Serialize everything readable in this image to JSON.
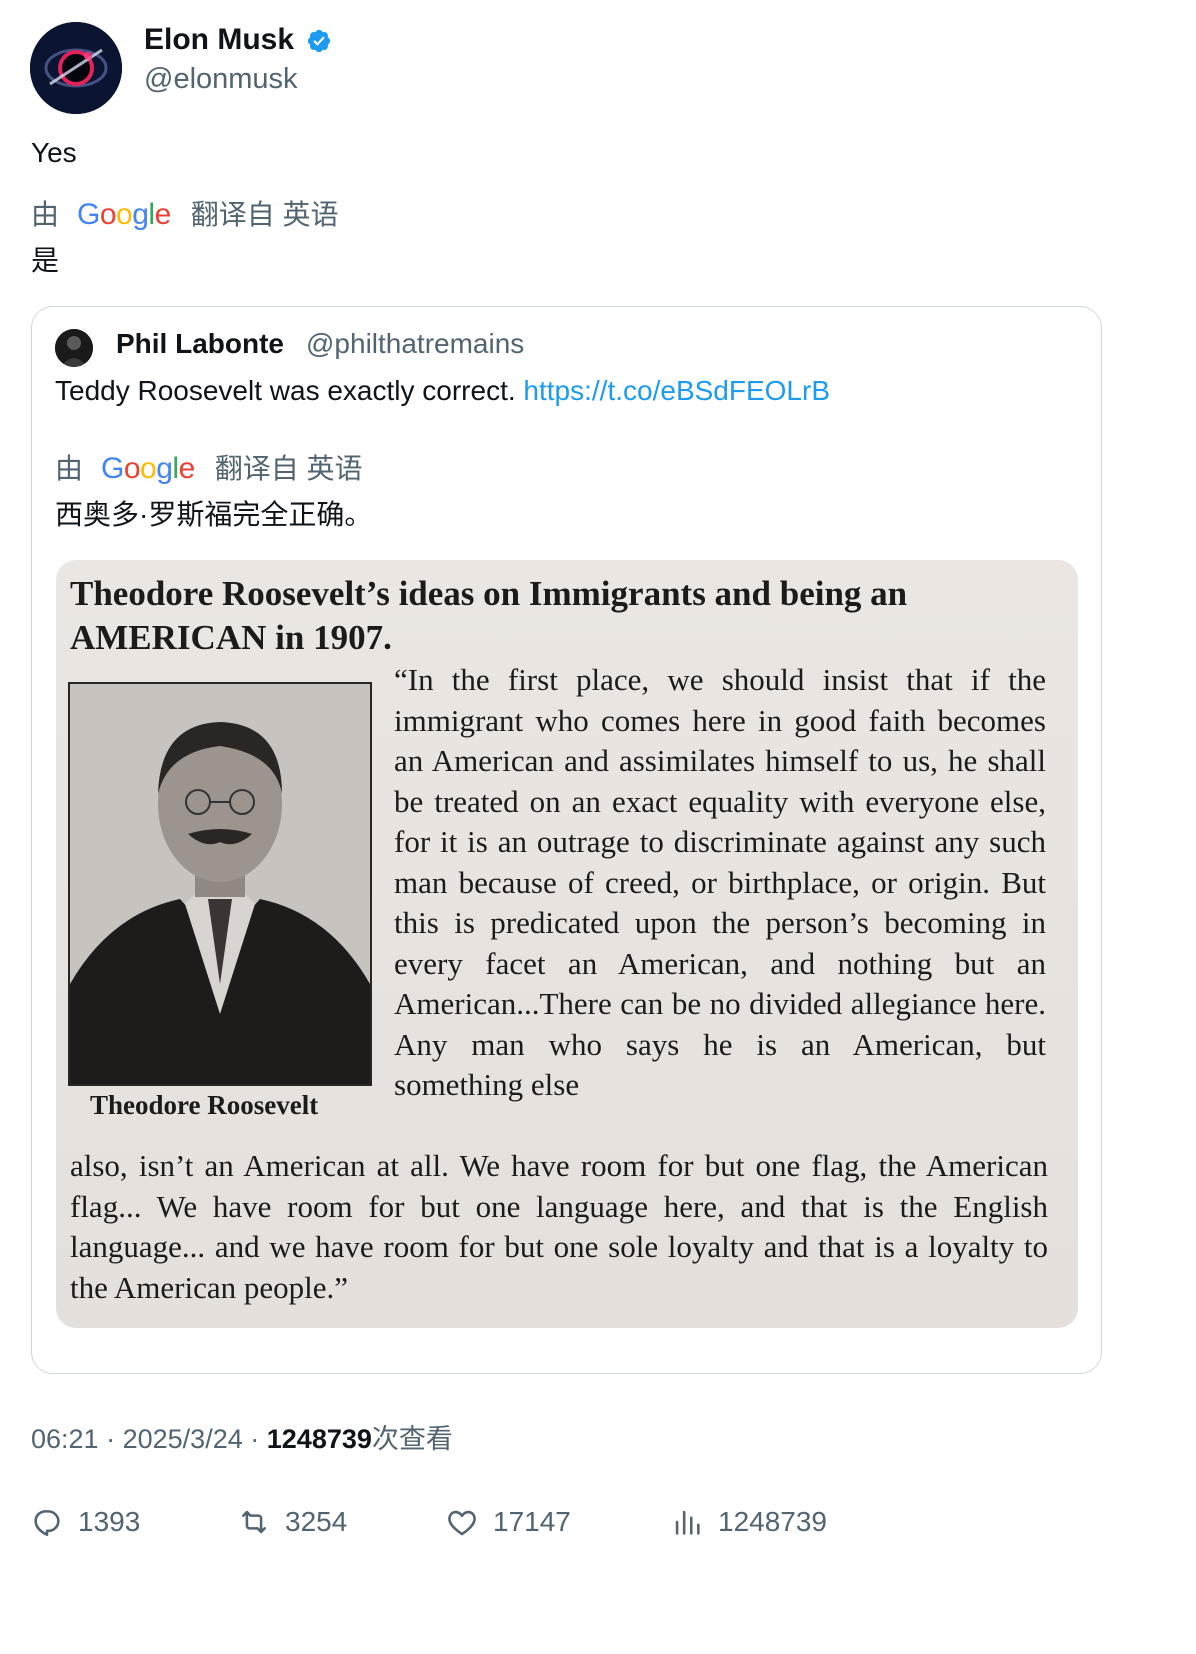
{
  "author": {
    "name": "Elon Musk",
    "handle": "@elonmusk",
    "verified": true,
    "verified_color": "#1d9bf0"
  },
  "tweet": {
    "text": "Yes",
    "translation": {
      "by": "由",
      "provider": "Google",
      "label": "翻译自 英语",
      "text": "是"
    }
  },
  "quoted": {
    "name": "Phil Labonte",
    "handle": "@philthatremains",
    "text": "Teddy Roosevelt was exactly correct.",
    "link": "https://t.co/eBSdFEOLrB",
    "translation": {
      "by": "由",
      "provider": "Google",
      "label": "翻译自 英语",
      "text": "西奥多·罗斯福完全正确。"
    },
    "image": {
      "title": "Theodore Roosevelt’s ideas on Immigrants and being an AMERICAN in 1907.",
      "caption": "Theodore Roosevelt",
      "body_part1": "“In the first place, we should insist that if the immigrant who comes here in good faith becomes an American and assimilates himself to us, he shall be treated on an exact equality with everyone else, for it is an outrage to discriminate against any such man because of creed, or birthplace, or origin. But this is predicated upon the person’s becoming in every facet an American, and nothing but an American...There can be no divided allegiance here. Any man who says he is an American, but something else",
      "body_part2": "also, isn’t an American at all. We have room for but one flag, the American flag... We have room for but one language here, and that is the English language... and we have room for but one sole loyalty and that is a loyalty to the American people.”"
    }
  },
  "meta": {
    "time": "06:21",
    "sep1": "·",
    "date": "2025/3/24",
    "sep2": "·",
    "views": "1248739",
    "views_label": "次查看"
  },
  "actions": {
    "replies": "1393",
    "retweets": "3254",
    "likes": "17147",
    "views": "1248739"
  },
  "google_letters": [
    "G",
    "o",
    "o",
    "g",
    "l",
    "e"
  ]
}
